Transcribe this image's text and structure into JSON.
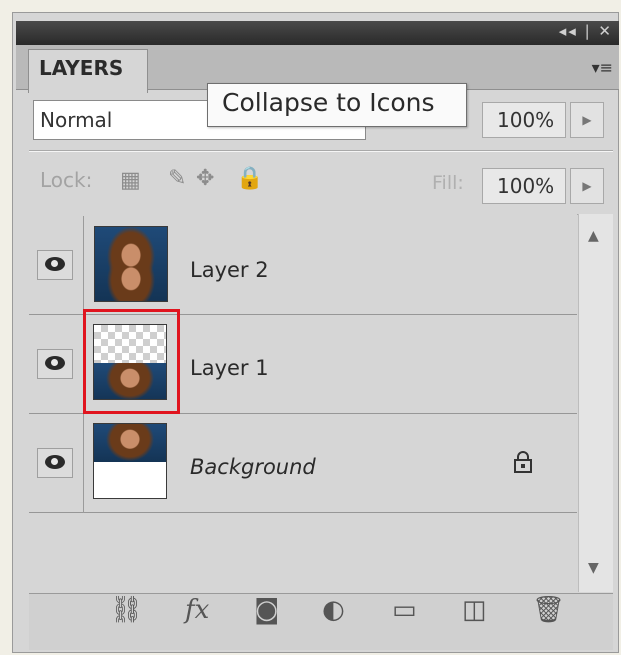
{
  "panel": {
    "tab_label": "LAYERS",
    "title_controls": "◂◂ | ✕",
    "menu_icon": "≡"
  },
  "tooltip": {
    "text": "Collapse to Icons"
  },
  "blend_mode": {
    "value": "Normal"
  },
  "opacity": {
    "value": "100%"
  },
  "lock": {
    "label": "Lock:"
  },
  "fill": {
    "label": "Fill:",
    "value": "100%"
  },
  "layers": [
    {
      "name": "Layer 2",
      "visible": true,
      "selected": false,
      "locked": false,
      "italic": false
    },
    {
      "name": "Layer 1",
      "visible": true,
      "selected": true,
      "locked": false,
      "italic": false
    },
    {
      "name": "Background",
      "visible": true,
      "selected": false,
      "locked": true,
      "italic": true
    }
  ],
  "bottom_bar": {
    "icons": [
      "link-icon",
      "fx-icon",
      "mask-icon",
      "adjustment-icon",
      "folder-icon",
      "new-layer-icon",
      "trash-icon"
    ],
    "fx_label": "fx"
  },
  "colors": {
    "highlight": "#e0141e",
    "panel_bg": "#d6d6d6"
  }
}
